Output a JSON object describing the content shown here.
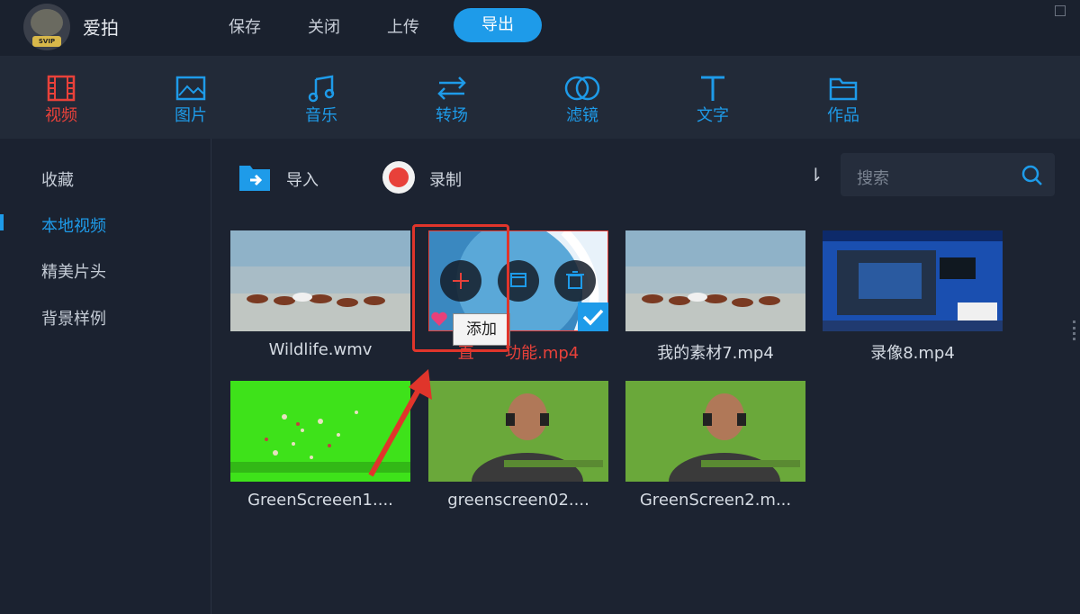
{
  "app": {
    "name": "爱拍",
    "logo_text": "SVIP"
  },
  "topmenu": {
    "save": "保存",
    "close": "关闭",
    "upload": "上传",
    "export": "导出"
  },
  "categories": [
    {
      "label": "视频",
      "icon": "film-icon",
      "active": true
    },
    {
      "label": "图片",
      "icon": "image-icon",
      "active": false
    },
    {
      "label": "音乐",
      "icon": "music-note-icon",
      "active": false
    },
    {
      "label": "转场",
      "icon": "transition-arrows-icon",
      "active": false
    },
    {
      "label": "滤镜",
      "icon": "filter-circles-icon",
      "active": false
    },
    {
      "label": "文字",
      "icon": "text-t-icon",
      "active": false
    },
    {
      "label": "作品",
      "icon": "folder-icon",
      "active": false
    }
  ],
  "sidebar": {
    "items": [
      "收藏",
      "本地视频",
      "精美片头",
      "背景样例"
    ],
    "active_index": 1
  },
  "toolbar": {
    "import": "导入",
    "record": "录制"
  },
  "search": {
    "placeholder": "搜索"
  },
  "media": [
    {
      "name": "Wildlife.wmv",
      "selected": false
    },
    {
      "name": "直…功能.mp4",
      "visible_fragment_left": "直",
      "visible_fragment_right": "功能.mp4",
      "selected": true
    },
    {
      "name": "我的素材7.mp4",
      "selected": false
    },
    {
      "name": "录像8.mp4",
      "selected": false
    },
    {
      "name": "GreenScreeen1....",
      "selected": false
    },
    {
      "name": "greenscreen02....",
      "selected": false
    },
    {
      "name": "GreenScreen2.m...",
      "selected": false
    }
  ],
  "tooltip": {
    "add": "添加"
  },
  "colors": {
    "accent": "#1e9be9",
    "active_red": "#e8413a",
    "annotation_red": "#e0352b"
  }
}
